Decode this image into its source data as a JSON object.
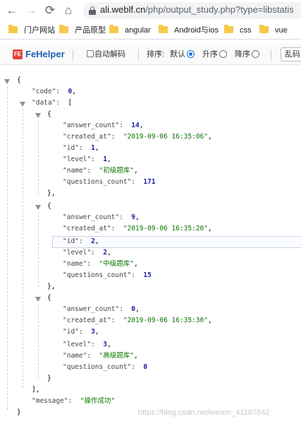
{
  "browser": {
    "url_host": "ali.weblf.cn",
    "url_path": "/php/output_study.php?type=libstatis",
    "bookmarks": [
      "门户网站",
      "产品原型",
      "angular",
      "Android与ios",
      "css",
      "vue"
    ]
  },
  "toolbar": {
    "title": "FeHelper",
    "logo": "FE",
    "auto_decode_label": "自动解码",
    "sort_label": "排序:",
    "sort_default": "默认",
    "sort_asc": "升序",
    "sort_desc": "降序",
    "luan_label": "乱码",
    "sort_selected": "默认"
  },
  "json": {
    "code": "0",
    "items": [
      {
        "answer_count": "14",
        "created_at": "\"2019-09-06 16:35:06\"",
        "id": "1",
        "level": "1",
        "name": "\"初级题库\"",
        "questions_count": "171"
      },
      {
        "answer_count": "9",
        "created_at": "\"2019-09-06 16:35:20\"",
        "id": "2",
        "level": "2",
        "name": "\"中级题库\"",
        "questions_count": "15"
      },
      {
        "answer_count": "0",
        "created_at": "\"2019-09-06 16:35:30\"",
        "id": "3",
        "level": "3",
        "name": "\"高级题库\"",
        "questions_count": "0"
      }
    ],
    "message": "\"操作成功\""
  },
  "keys": {
    "code": "\"code\":",
    "data": "\"data\":",
    "answer_count": "\"answer_count\":",
    "created_at": "\"created_at\":",
    "id": "\"id\":",
    "level": "\"level\":",
    "name": "\"name\":",
    "questions_count": "\"questions_count\":",
    "message": "\"message\":"
  },
  "watermark": "https://blog.csdn.net/weixin_41187842"
}
